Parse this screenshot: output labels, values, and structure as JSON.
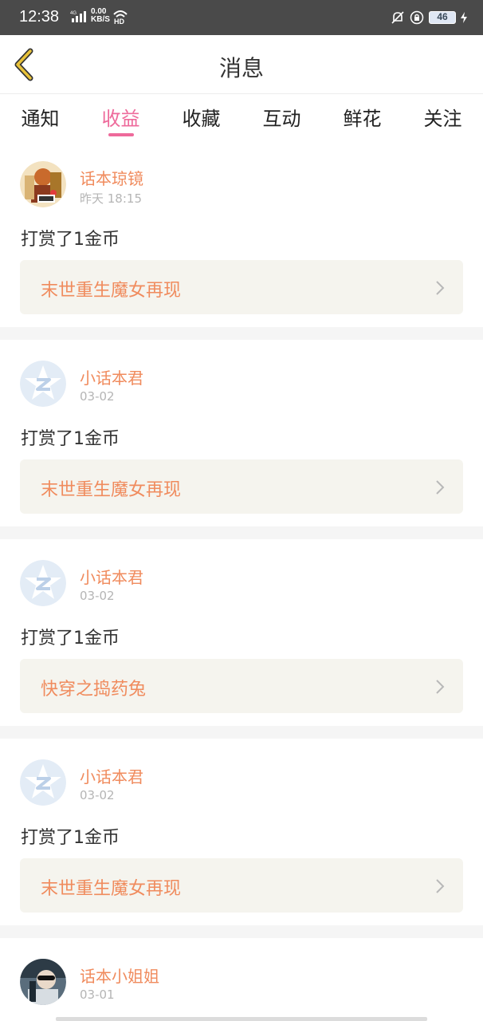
{
  "status_bar": {
    "time": "12:38",
    "speed_top": "0.00",
    "speed_bottom": "KB/S",
    "battery": "46",
    "network_label": "4G",
    "hd_label": "HD"
  },
  "header": {
    "title": "消息",
    "back_icon": "back-chevron-icon"
  },
  "tabs": [
    {
      "label": "通知",
      "active": false
    },
    {
      "label": "收益",
      "active": true
    },
    {
      "label": "收藏",
      "active": false
    },
    {
      "label": "互动",
      "active": false
    },
    {
      "label": "鲜花",
      "active": false
    },
    {
      "label": "关注",
      "active": false
    }
  ],
  "messages": [
    {
      "user": "话本琼镜",
      "time": "昨天 18:15",
      "action": "打赏了1金币",
      "book": "末世重生魔女再现",
      "avatar": "custom-photo"
    },
    {
      "user": "小话本君",
      "time": "03-02",
      "action": "打赏了1金币",
      "book": "末世重生魔女再现",
      "avatar": "default-star"
    },
    {
      "user": "小话本君",
      "time": "03-02",
      "action": "打赏了1金币",
      "book": "快穿之捣药兔",
      "avatar": "default-star"
    },
    {
      "user": "小话本君",
      "time": "03-02",
      "action": "打赏了1金币",
      "book": "末世重生魔女再现",
      "avatar": "default-star"
    },
    {
      "user": "话本小姐姐",
      "time": "03-01",
      "avatar": "custom-photo-2"
    }
  ],
  "colors": {
    "accent_pink": "#ee6a9b",
    "name_orange": "#f08b5d",
    "back_yellow": "#e8c23a",
    "book_box_bg": "#f5f4ee"
  }
}
